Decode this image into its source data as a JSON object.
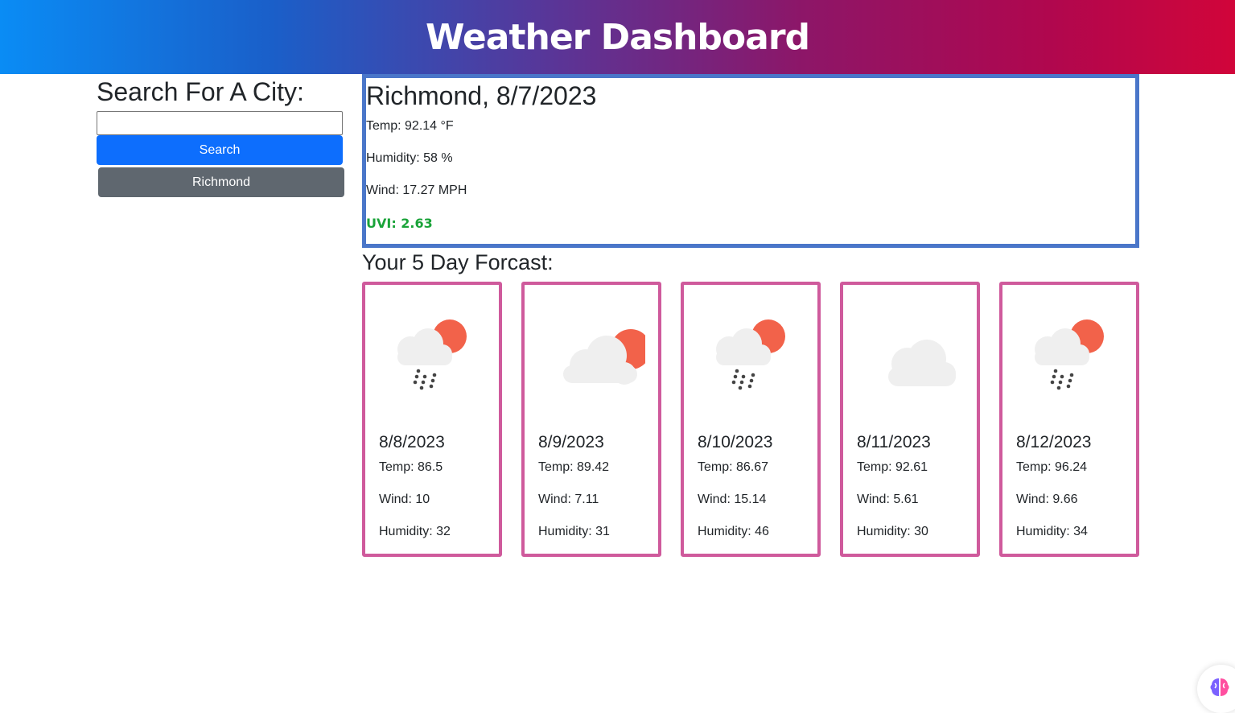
{
  "header": {
    "title": "Weather Dashboard"
  },
  "sidebar": {
    "heading": "Search For A City:",
    "search_value": "",
    "search_button": "Search",
    "history": [
      "Richmond"
    ]
  },
  "current": {
    "heading": "Richmond, 8/7/2023",
    "temp": "Temp: 92.14 °F",
    "humidity": "Humidity: 58 %",
    "wind": "Wind: 17.27 MPH",
    "uvi": "UVI: 2.63",
    "uvi_color": "#1aa339"
  },
  "forecast": {
    "title": "Your 5 Day Forcast:",
    "days": [
      {
        "date": "8/8/2023",
        "temp": "Temp: 86.5",
        "wind": "Wind: 10",
        "humidity": "Humidity: 32",
        "icon": "rain-sun-icon"
      },
      {
        "date": "8/9/2023",
        "temp": "Temp: 89.42",
        "wind": "Wind: 7.11",
        "humidity": "Humidity: 31",
        "icon": "cloud-sun-icon"
      },
      {
        "date": "8/10/2023",
        "temp": "Temp: 86.67",
        "wind": "Wind: 15.14",
        "humidity": "Humidity: 46",
        "icon": "rain-sun-icon"
      },
      {
        "date": "8/11/2023",
        "temp": "Temp: 92.61",
        "wind": "Wind: 5.61",
        "humidity": "Humidity: 30",
        "icon": "cloud-icon"
      },
      {
        "date": "8/12/2023",
        "temp": "Temp: 96.24",
        "wind": "Wind: 9.66",
        "humidity": "Humidity: 34",
        "icon": "rain-sun-icon"
      }
    ]
  },
  "colors": {
    "search_button": "#0d6efd",
    "history_button": "#5f676f",
    "current_border": "#4a76c9",
    "card_border": "#cf5a9c"
  }
}
